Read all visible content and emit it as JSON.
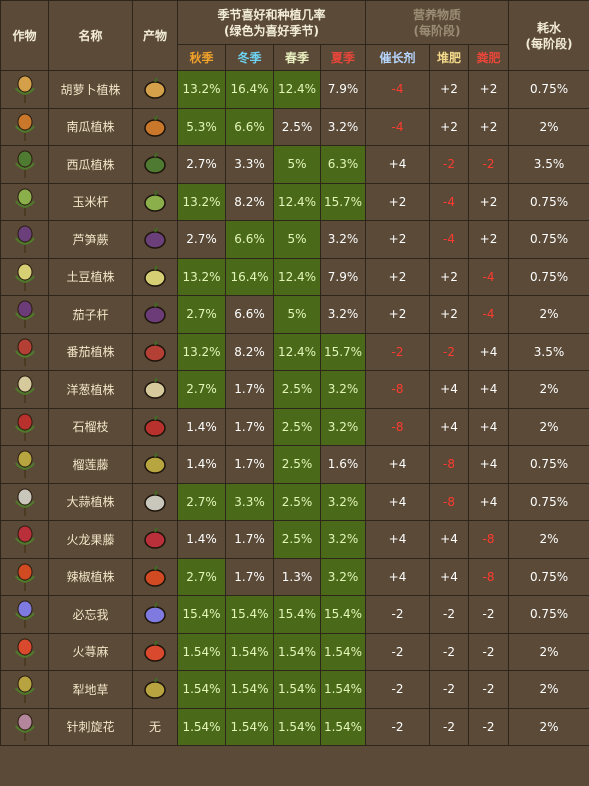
{
  "header": {
    "col_crop": "作物",
    "col_name": "名称",
    "col_product": "产物",
    "season_group": "季节喜好和种植几率\n(绿色为喜好季节)",
    "nutrient_group": "营养物质\n(每阶段)",
    "water_group": "耗水\n(每阶段)",
    "season_autumn": "秋季",
    "season_winter": "冬季",
    "season_spring": "春季",
    "season_summer": "夏季",
    "nutrient_grow": "催长剂",
    "nutrient_compost": "堆肥",
    "nutrient_manure": "粪肥"
  },
  "rows": [
    {
      "name": "胡萝卜植株",
      "product_icon": "carrot-icon",
      "plant_icon": "carrot-plant-icon",
      "autumn": "13.2%",
      "winter": "16.4%",
      "spring": "12.4%",
      "summer": "7.9%",
      "good": [
        true,
        true,
        true,
        false
      ],
      "grow": "-4",
      "compost": "+2",
      "manure": "+2",
      "water": "0.75%",
      "red": [
        true,
        false,
        false
      ]
    },
    {
      "name": "南瓜植株",
      "product_icon": "pumpkin-icon",
      "plant_icon": "pumpkin-plant-icon",
      "autumn": "5.3%",
      "winter": "6.6%",
      "spring": "2.5%",
      "summer": "3.2%",
      "good": [
        true,
        true,
        false,
        false
      ],
      "grow": "-4",
      "compost": "+2",
      "manure": "+2",
      "water": "2%",
      "red": [
        true,
        false,
        false
      ]
    },
    {
      "name": "西瓜植株",
      "product_icon": "watermelon-icon",
      "plant_icon": "watermelon-plant-icon",
      "autumn": "2.7%",
      "winter": "3.3%",
      "spring": "5%",
      "summer": "6.3%",
      "good": [
        false,
        false,
        true,
        true
      ],
      "grow": "+4",
      "compost": "-2",
      "manure": "-2",
      "water": "3.5%",
      "red": [
        false,
        true,
        true
      ]
    },
    {
      "name": "玉米杆",
      "product_icon": "corn-icon",
      "plant_icon": "corn-plant-icon",
      "autumn": "13.2%",
      "winter": "8.2%",
      "spring": "12.4%",
      "summer": "15.7%",
      "good": [
        true,
        false,
        true,
        true
      ],
      "grow": "+2",
      "compost": "-4",
      "manure": "+2",
      "water": "0.75%",
      "red": [
        false,
        true,
        false
      ]
    },
    {
      "name": "芦笋蕨",
      "product_icon": "asparagus-icon",
      "plant_icon": "asparagus-plant-icon",
      "autumn": "2.7%",
      "winter": "6.6%",
      "spring": "5%",
      "summer": "3.2%",
      "good": [
        false,
        true,
        true,
        false
      ],
      "grow": "+2",
      "compost": "-4",
      "manure": "+2",
      "water": "0.75%",
      "red": [
        false,
        true,
        false
      ]
    },
    {
      "name": "土豆植株",
      "product_icon": "potato-icon",
      "plant_icon": "potato-plant-icon",
      "autumn": "13.2%",
      "winter": "16.4%",
      "spring": "12.4%",
      "summer": "7.9%",
      "good": [
        true,
        true,
        true,
        false
      ],
      "grow": "+2",
      "compost": "+2",
      "manure": "-4",
      "water": "0.75%",
      "red": [
        false,
        false,
        true
      ]
    },
    {
      "name": "茄子杆",
      "product_icon": "eggplant-icon",
      "plant_icon": "eggplant-plant-icon",
      "autumn": "2.7%",
      "winter": "6.6%",
      "spring": "5%",
      "summer": "3.2%",
      "good": [
        true,
        false,
        true,
        false
      ],
      "grow": "+2",
      "compost": "+2",
      "manure": "-4",
      "water": "2%",
      "red": [
        false,
        false,
        true
      ]
    },
    {
      "name": "番茄植株",
      "product_icon": "tomato-icon",
      "plant_icon": "tomato-plant-icon",
      "autumn": "13.2%",
      "winter": "8.2%",
      "spring": "12.4%",
      "summer": "15.7%",
      "good": [
        true,
        false,
        true,
        true
      ],
      "grow": "-2",
      "compost": "-2",
      "manure": "+4",
      "water": "3.5%",
      "red": [
        true,
        true,
        false
      ]
    },
    {
      "name": "洋葱植株",
      "product_icon": "onion-icon",
      "plant_icon": "onion-plant-icon",
      "autumn": "2.7%",
      "winter": "1.7%",
      "spring": "2.5%",
      "summer": "3.2%",
      "good": [
        true,
        false,
        true,
        true
      ],
      "grow": "-8",
      "compost": "+4",
      "manure": "+4",
      "water": "2%",
      "red": [
        true,
        false,
        false
      ]
    },
    {
      "name": "石榴枝",
      "product_icon": "pomegranate-icon",
      "plant_icon": "pomegranate-plant-icon",
      "autumn": "1.4%",
      "winter": "1.7%",
      "spring": "2.5%",
      "summer": "3.2%",
      "good": [
        false,
        false,
        true,
        true
      ],
      "grow": "-8",
      "compost": "+4",
      "manure": "+4",
      "water": "2%",
      "red": [
        true,
        false,
        false
      ]
    },
    {
      "name": "榴莲藤",
      "product_icon": "durian-icon",
      "plant_icon": "durian-plant-icon",
      "autumn": "1.4%",
      "winter": "1.7%",
      "spring": "2.5%",
      "summer": "1.6%",
      "good": [
        false,
        false,
        true,
        false
      ],
      "grow": "+4",
      "compost": "-8",
      "manure": "+4",
      "water": "0.75%",
      "red": [
        false,
        true,
        false
      ]
    },
    {
      "name": "大蒜植株",
      "product_icon": "garlic-icon",
      "plant_icon": "garlic-plant-icon",
      "autumn": "2.7%",
      "winter": "3.3%",
      "spring": "2.5%",
      "summer": "3.2%",
      "good": [
        true,
        true,
        true,
        true
      ],
      "grow": "+4",
      "compost": "-8",
      "manure": "+4",
      "water": "0.75%",
      "red": [
        false,
        true,
        false
      ]
    },
    {
      "name": "火龙果藤",
      "product_icon": "dragonfruit-icon",
      "plant_icon": "dragonfruit-plant-icon",
      "autumn": "1.4%",
      "winter": "1.7%",
      "spring": "2.5%",
      "summer": "3.2%",
      "good": [
        false,
        false,
        true,
        true
      ],
      "grow": "+4",
      "compost": "+4",
      "manure": "-8",
      "water": "2%",
      "red": [
        false,
        false,
        true
      ]
    },
    {
      "name": "辣椒植株",
      "product_icon": "pepper-icon",
      "plant_icon": "pepper-plant-icon",
      "autumn": "2.7%",
      "winter": "1.7%",
      "spring": "1.3%",
      "summer": "3.2%",
      "good": [
        true,
        false,
        false,
        true
      ],
      "grow": "+4",
      "compost": "+4",
      "manure": "-8",
      "water": "0.75%",
      "red": [
        false,
        false,
        true
      ]
    },
    {
      "name": "必忘我",
      "product_icon": "forgetmenot-icon",
      "plant_icon": "forgetmenot-plant-icon",
      "autumn": "15.4%",
      "winter": "15.4%",
      "spring": "15.4%",
      "summer": "15.4%",
      "good": [
        true,
        true,
        true,
        true
      ],
      "grow": "-2",
      "compost": "-2",
      "manure": "-2",
      "water": "0.75%",
      "red": [
        false,
        false,
        false
      ]
    },
    {
      "name": "火荨麻",
      "product_icon": "firenettle-icon",
      "plant_icon": "firenettle-plant-icon",
      "autumn": "1.54%",
      "winter": "1.54%",
      "spring": "1.54%",
      "summer": "1.54%",
      "good": [
        true,
        true,
        true,
        true
      ],
      "grow": "-2",
      "compost": "-2",
      "manure": "-2",
      "water": "2%",
      "red": [
        false,
        false,
        false
      ]
    },
    {
      "name": "犁地草",
      "product_icon": "tillweed-icon",
      "plant_icon": "tillweed-plant-icon",
      "autumn": "1.54%",
      "winter": "1.54%",
      "spring": "1.54%",
      "summer": "1.54%",
      "good": [
        true,
        true,
        true,
        true
      ],
      "grow": "-2",
      "compost": "-2",
      "manure": "-2",
      "water": "2%",
      "red": [
        false,
        false,
        false
      ]
    },
    {
      "name": "针刺旋花",
      "product_icon": "",
      "plant_icon": "spinyweed-plant-icon",
      "product_text": "无",
      "autumn": "1.54%",
      "winter": "1.54%",
      "spring": "1.54%",
      "summer": "1.54%",
      "good": [
        true,
        true,
        true,
        true
      ],
      "grow": "-2",
      "compost": "-2",
      "manure": "-2",
      "water": "2%",
      "red": [
        false,
        false,
        false
      ]
    }
  ],
  "colors": {
    "background": "#5a4a37",
    "good_cell": "#4a6a1a",
    "border": "#2f261b",
    "negative": "#ff3b30"
  }
}
